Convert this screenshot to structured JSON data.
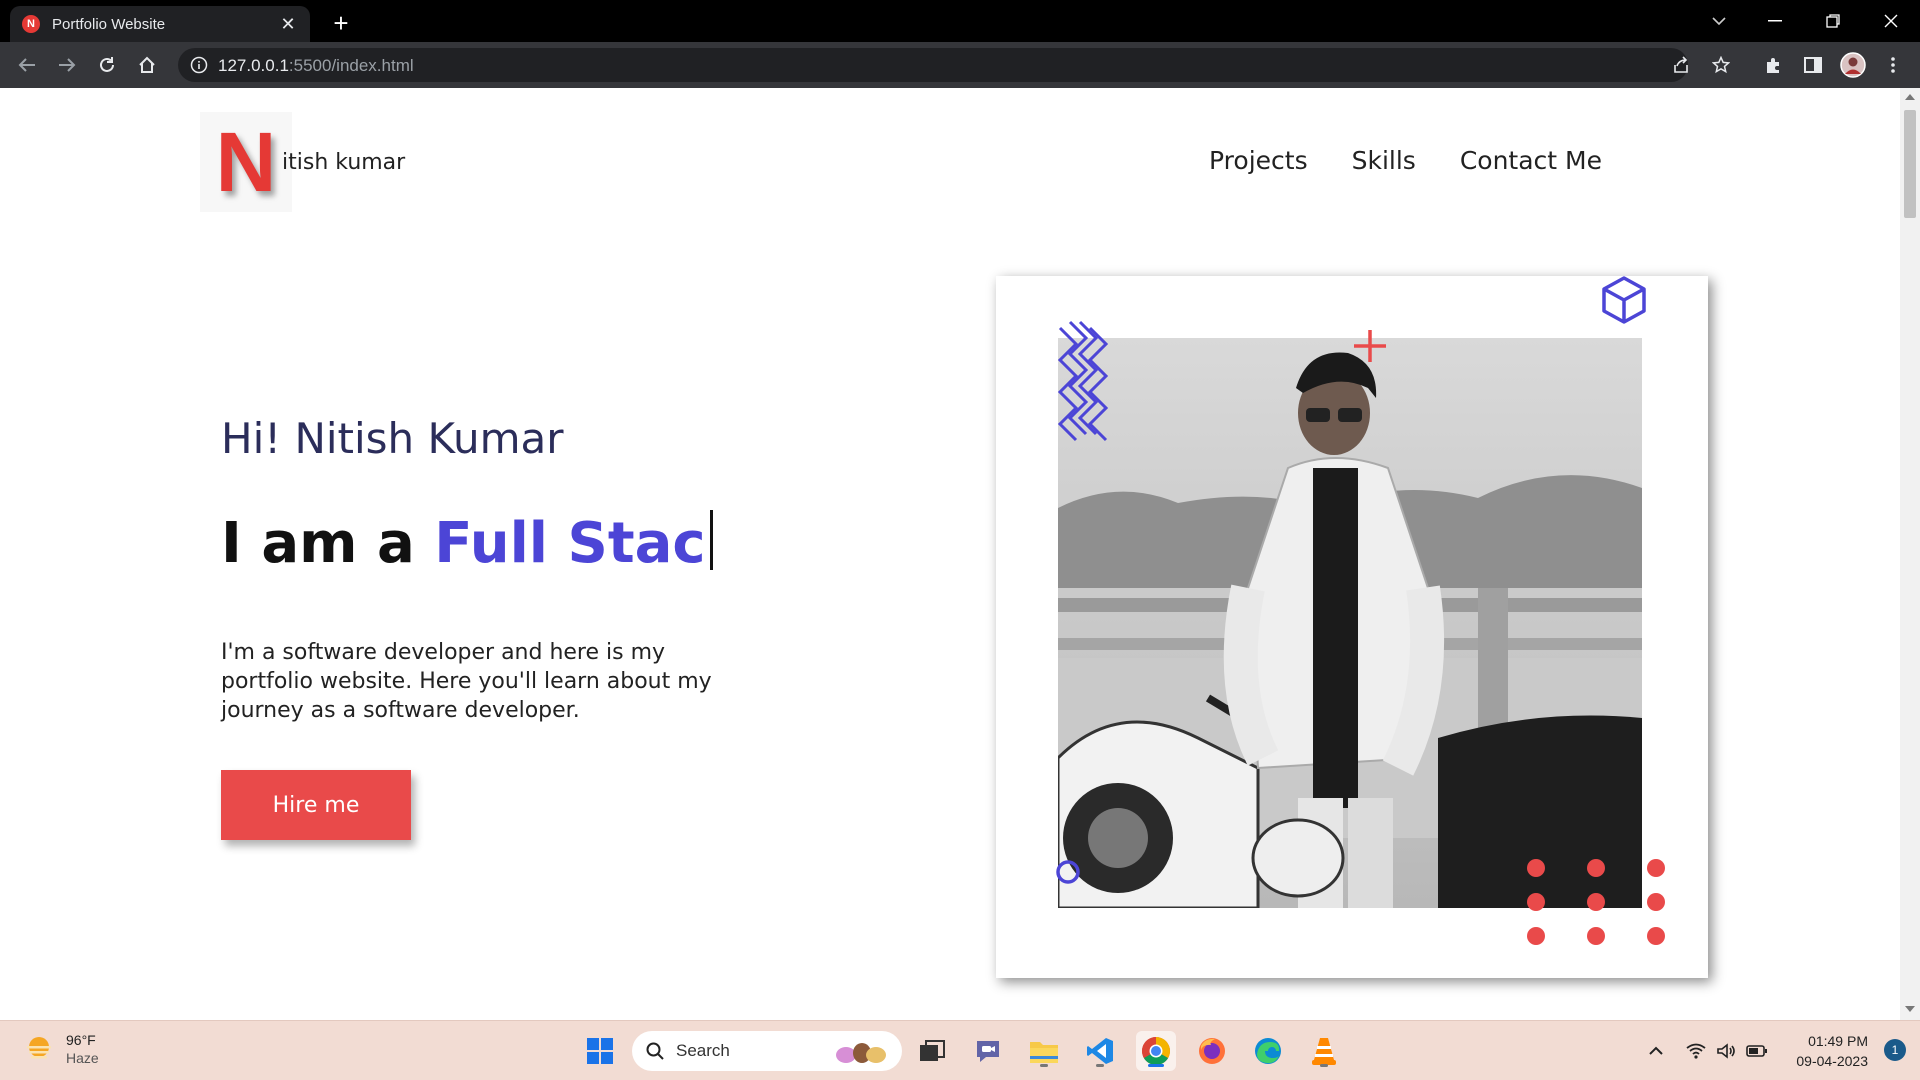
{
  "browser": {
    "tab_title": "Portfolio Website",
    "favicon_letter": "N",
    "url_host": "127.0.0.1",
    "url_rest": ":5500/index.html"
  },
  "site": {
    "logo_letter": "N",
    "logo_text": "itish kumar",
    "nav": [
      "Projects",
      "Skills",
      "Contact Me"
    ],
    "greeting": "Hi! Nitish Kumar",
    "headline_prefix": "I am a ",
    "headline_role": "Full Stac",
    "intro": "I'm a software developer and here is my portfolio website. Here you'll learn about my journey as a software developer.",
    "hire_label": "Hire me",
    "accent_color": "#4c45d6",
    "brand_red": "#e94a4a"
  },
  "taskbar": {
    "weather_temp": "96°F",
    "weather_desc": "Haze",
    "search_placeholder": "Search",
    "time": "01:49 PM",
    "date": "09-04-2023",
    "notification_count": "1"
  }
}
